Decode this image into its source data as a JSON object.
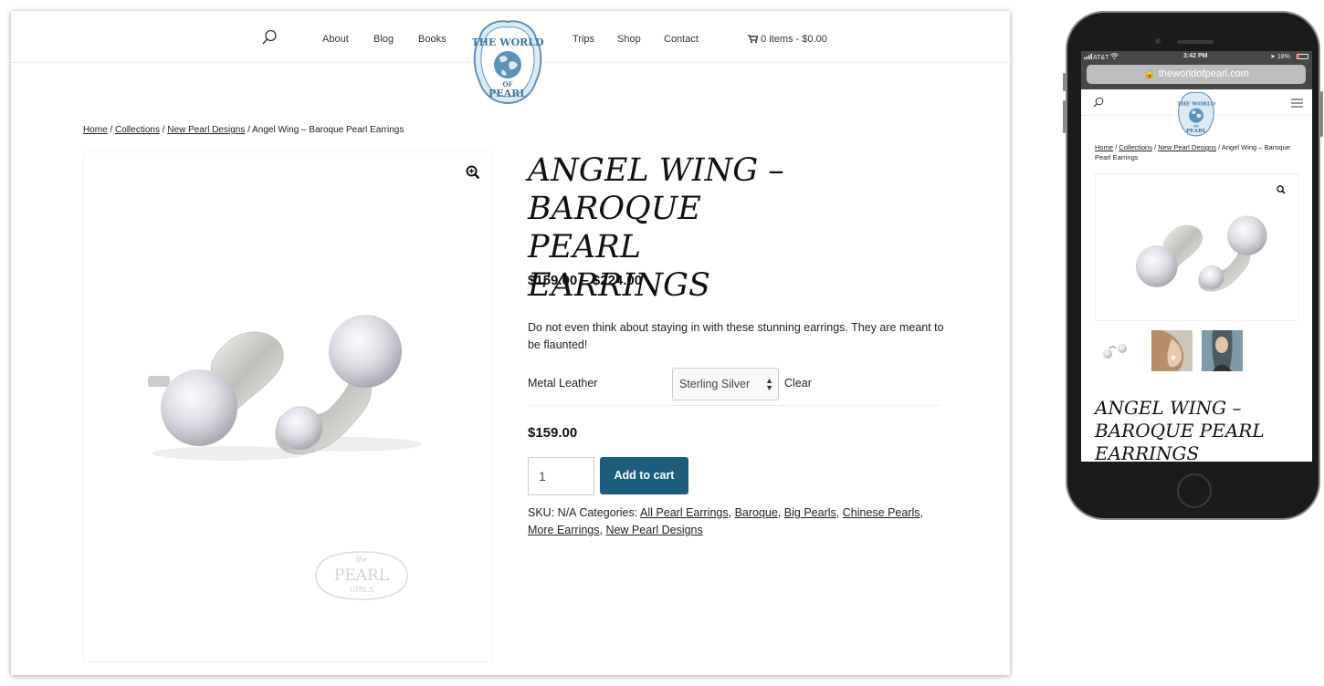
{
  "desktop": {
    "nav": {
      "about": "About",
      "blog": "Blog",
      "books": "Books",
      "trips": "Trips",
      "shop": "Shop",
      "contact": "Contact",
      "cart": "0 items - $0.00"
    },
    "logo": {
      "line1": "THE WORLD",
      "line2": "OF",
      "line3": "PEARL"
    },
    "breadcrumb": {
      "home": "Home",
      "collections": "Collections",
      "new_pearl_designs": "New Pearl Designs",
      "current": "Angel Wing – Baroque Pearl Earrings",
      "sep": " / "
    },
    "watermark": {
      "top": "the",
      "main": "PEARL",
      "bottom": "GIRLS"
    },
    "product": {
      "title": "ANGEL WING – BAROQUE PEARL EARRINGS",
      "price_range": "$159.00 – $224.00",
      "description": "Do not even think about staying in with these stunning earrings. They are meant to be flaunted!",
      "variation_label": "Metal Leather",
      "variation_selected": "Sterling Silver",
      "clear": "Clear",
      "variation_price": "$159.00",
      "quantity": "1",
      "add_to_cart": "Add to cart",
      "sku_label": "SKU:",
      "sku_value": "N/A",
      "categories_label": "Categories:",
      "categories": [
        "All Pearl Earrings",
        "Baroque",
        "Big Pearls",
        "Chinese Pearls",
        "More Earrings",
        "New Pearl Designs"
      ]
    }
  },
  "mobile": {
    "status": {
      "carrier": "AT&T",
      "time": "3:42 PM",
      "battery": "18%"
    },
    "url": "theworldofpearl.com",
    "breadcrumb": {
      "home": "Home",
      "collections": "Collections",
      "new_pearl_designs": "New Pearl Designs",
      "current": "Angel Wing – Baroque Pearl Earrings"
    },
    "title": "ANGEL WING – BAROQUE PEARL EARRINGS"
  },
  "colors": {
    "accent": "#1c5d7e",
    "logo_blue": "#5b93b8",
    "battery_low": "#e33333"
  }
}
